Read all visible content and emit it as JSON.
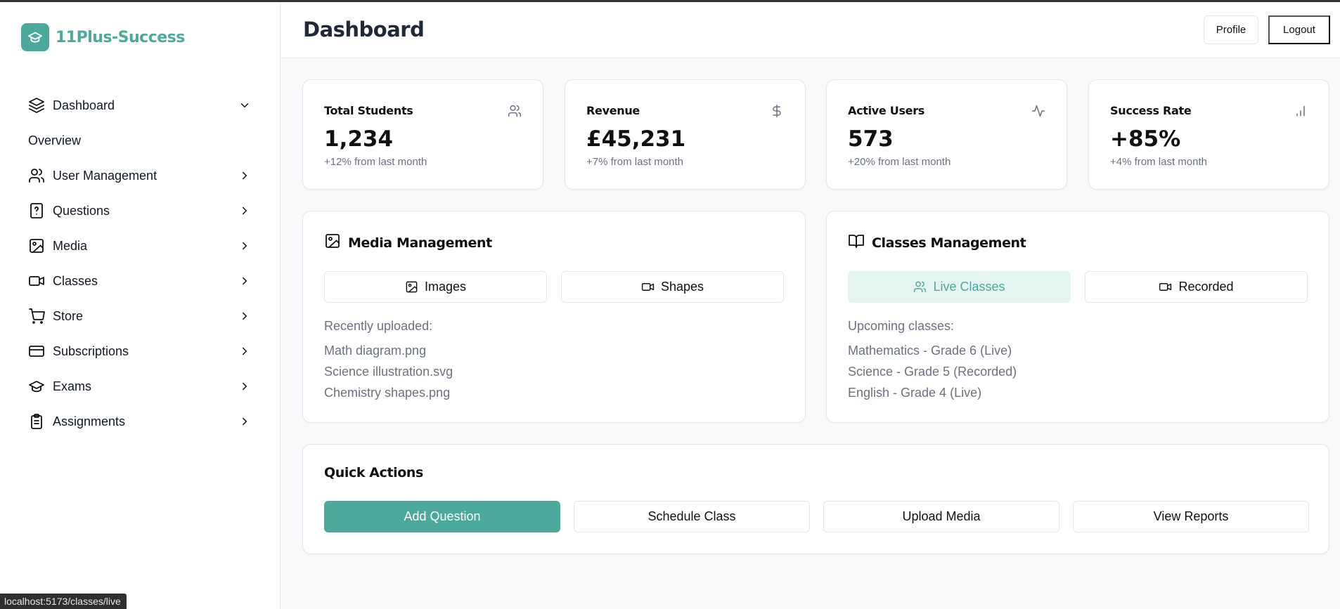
{
  "brand": {
    "name": "11Plus-Success",
    "icon": "graduation-cap-icon"
  },
  "colors": {
    "accent": "#4baa9b",
    "accent_light": "#e6f4f1",
    "muted_text": "#6b7280",
    "border": "#e5e7eb"
  },
  "sidebar": {
    "items": [
      {
        "label": "Dashboard",
        "icon": "layers-icon",
        "chevron": "chevron-down-icon"
      },
      {
        "label": "Overview"
      },
      {
        "label": "User Management",
        "icon": "users-icon",
        "chevron": "chevron-right-icon"
      },
      {
        "label": "Questions",
        "icon": "file-question-icon",
        "chevron": "chevron-right-icon"
      },
      {
        "label": "Media",
        "icon": "image-icon",
        "chevron": "chevron-right-icon"
      },
      {
        "label": "Classes",
        "icon": "video-icon",
        "chevron": "chevron-right-icon"
      },
      {
        "label": "Store",
        "icon": "shopping-cart-icon",
        "chevron": "chevron-right-icon"
      },
      {
        "label": "Subscriptions",
        "icon": "credit-card-icon",
        "chevron": "chevron-right-icon"
      },
      {
        "label": "Exams",
        "icon": "graduation-cap-icon",
        "chevron": "chevron-right-icon"
      },
      {
        "label": "Assignments",
        "icon": "clipboard-icon",
        "chevron": "chevron-right-icon"
      }
    ]
  },
  "header": {
    "title": "Dashboard",
    "profile_label": "Profile",
    "logout_label": "Logout"
  },
  "stats": [
    {
      "title": "Total Students",
      "value": "1,234",
      "sub": "+12% from last month",
      "icon": "users-icon"
    },
    {
      "title": "Revenue",
      "value": "£45,231",
      "sub": "+7% from last month",
      "icon": "dollar-icon"
    },
    {
      "title": "Active Users",
      "value": "573",
      "sub": "+20% from last month",
      "icon": "activity-icon"
    },
    {
      "title": "Success Rate",
      "value": "+85%",
      "sub": "+4% from last month",
      "icon": "bar-chart-icon"
    }
  ],
  "media": {
    "title": "Media Management",
    "buttons": [
      "Images",
      "Shapes"
    ],
    "list_heading": "Recently uploaded:",
    "items": [
      "Math diagram.png",
      "Science illustration.svg",
      "Chemistry shapes.png"
    ]
  },
  "classes": {
    "title": "Classes Management",
    "buttons": [
      "Live Classes",
      "Recorded"
    ],
    "list_heading": "Upcoming classes:",
    "items": [
      "Mathematics - Grade 6 (Live)",
      "Science - Grade 5 (Recorded)",
      "English - Grade 4 (Live)"
    ]
  },
  "quick_actions": {
    "title": "Quick Actions",
    "buttons": [
      "Add Question",
      "Schedule Class",
      "Upload Media",
      "View Reports"
    ]
  },
  "status_bar": {
    "url": "localhost:5173/classes/live"
  }
}
